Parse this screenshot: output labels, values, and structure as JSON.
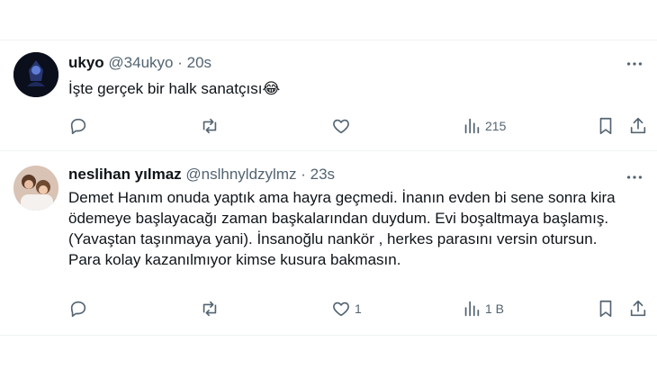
{
  "tweets": [
    {
      "name": "ukyo",
      "handle": "@34ukyo",
      "separator": "·",
      "time": "20s",
      "text": "İşte gerçek bir halk sanatçısı😂",
      "avatar_text": "KUM SIL",
      "actions": {
        "reply": "",
        "retweet": "",
        "like": "",
        "views": "215"
      }
    },
    {
      "name": "neslihan yılmaz",
      "handle": "@nslhnyldzylmz",
      "separator": "·",
      "time": "23s",
      "text": "Demet Hanım onuda yaptık ama hayra geçmedi. İnanın evden bi sene sonra kira ödemeye başlayacağı zaman başkalarından duydum. Evi boşaltmaya başlamış. (Yavaştan taşınmaya yani).  İnsanoğlu nankör , herkes parasını versin otursun. Para kolay kazanılmıyor kimse kusura bakmasın.",
      "actions": {
        "reply": "",
        "retweet": "",
        "like": "1",
        "views": "1 B"
      }
    }
  ],
  "icons": {
    "reply": "reply-icon",
    "retweet": "retweet-icon",
    "like": "heart-icon",
    "views": "views-chart-icon",
    "bookmark": "bookmark-icon",
    "share": "share-icon",
    "more": "more-dots-icon"
  },
  "colors": {
    "text": "#0f1419",
    "secondary": "#536471",
    "divider": "#eff3f4"
  }
}
